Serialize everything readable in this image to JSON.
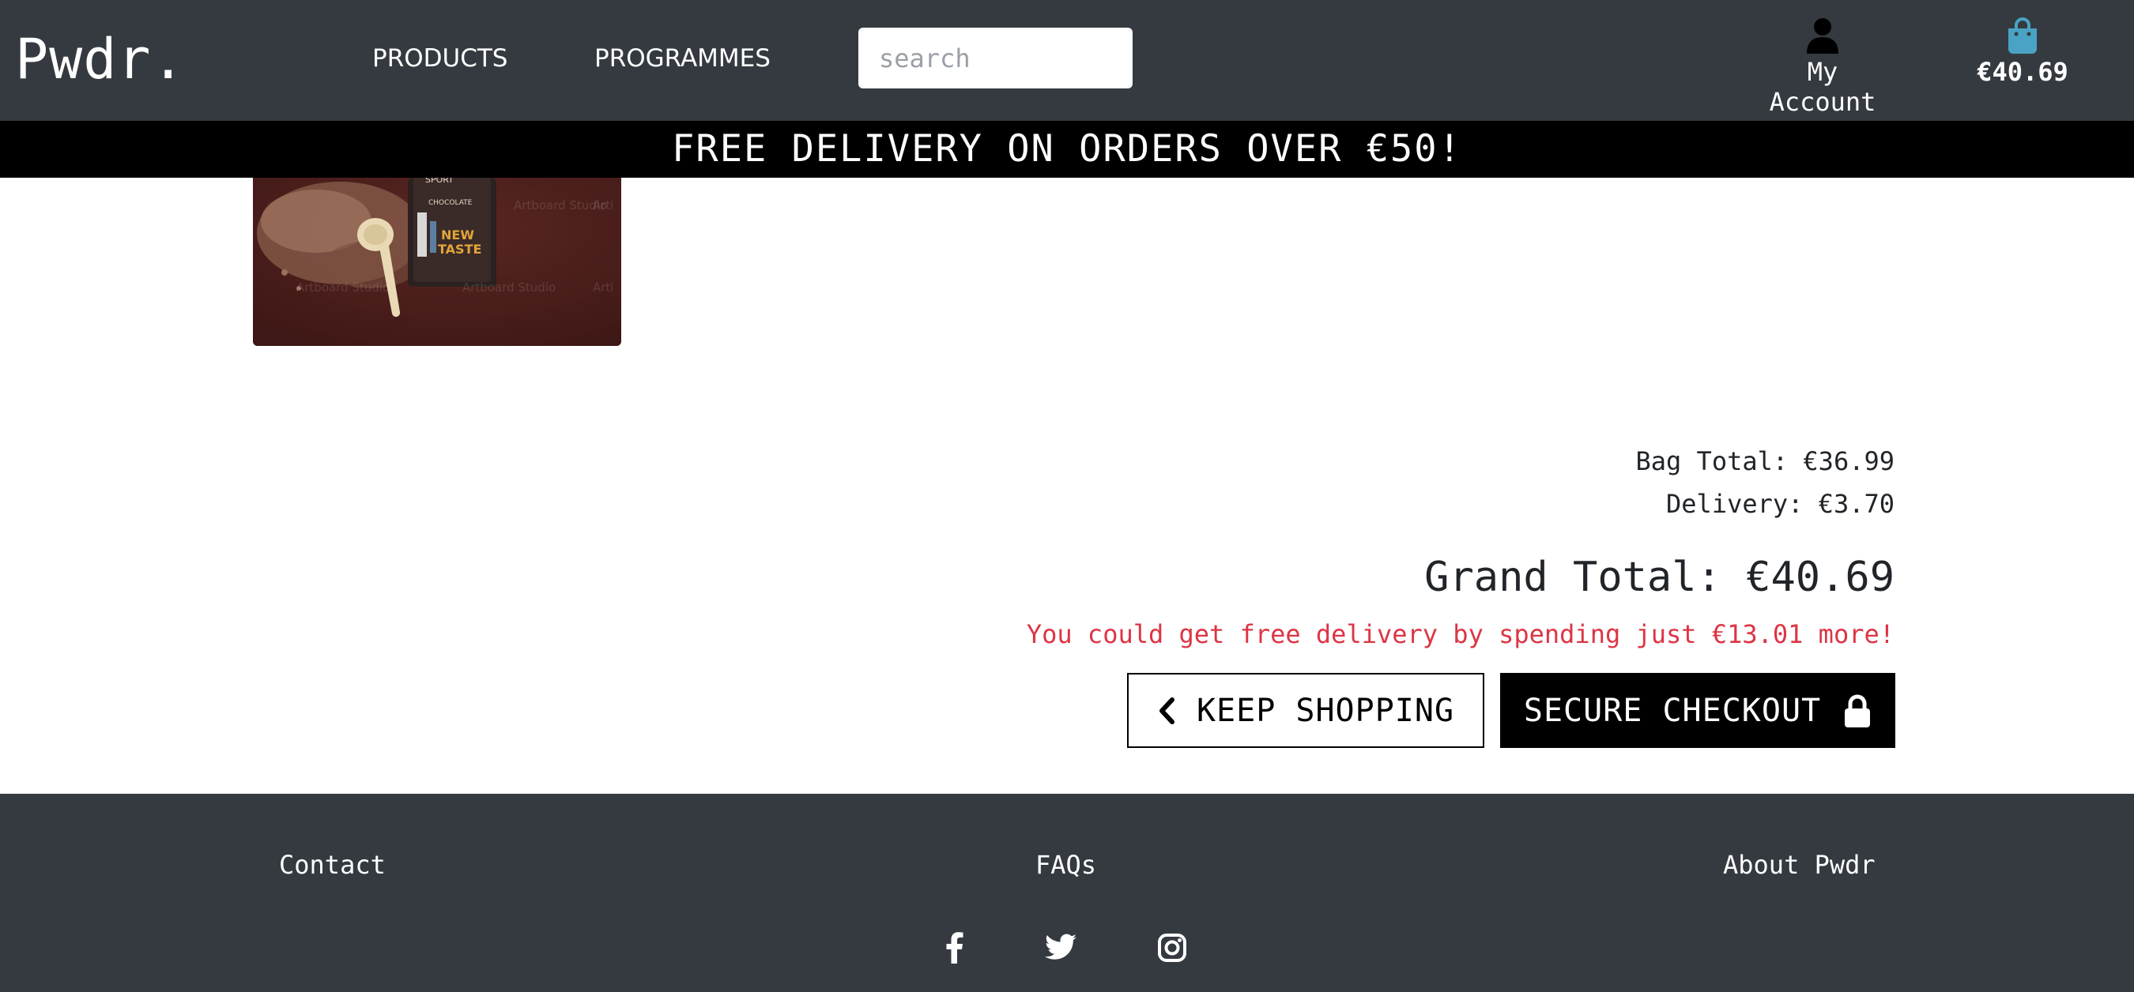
{
  "header": {
    "logo": "Pwdr.",
    "nav": [
      {
        "label": "PRODUCTS"
      },
      {
        "label": "PROGRAMMES"
      }
    ],
    "search": {
      "placeholder": "search",
      "value": "",
      "button_icon": "search-icon"
    },
    "account": {
      "icon": "user-icon",
      "label": "My Account"
    },
    "bag": {
      "icon": "shopping-bag-icon",
      "amount": "€40.69",
      "icon_color": "#4aa3c4"
    }
  },
  "banner": {
    "text": "FREE DELIVERY ON ORDERS OVER €50!"
  },
  "product": {
    "image_icon": "product-image"
  },
  "totals": {
    "bag_total": "Bag Total: €36.99",
    "delivery": "Delivery: €3.70",
    "grand_total": "Grand Total: €40.69",
    "free_delivery_message": "You could get free delivery by spending just €13.01 more!",
    "message_color": "#dc3545"
  },
  "actions": {
    "keep_shopping": "KEEP SHOPPING",
    "keep_shopping_icon": "chevron-left-icon",
    "secure_checkout": "SECURE CHECKOUT",
    "secure_checkout_icon": "lock-icon"
  },
  "footer": {
    "links": [
      {
        "label": "Contact"
      },
      {
        "label": "FAQs"
      },
      {
        "label": "About Pwdr"
      }
    ],
    "social": [
      {
        "icon": "facebook-icon"
      },
      {
        "icon": "twitter-icon"
      },
      {
        "icon": "instagram-icon"
      }
    ],
    "background": "#343a40"
  }
}
